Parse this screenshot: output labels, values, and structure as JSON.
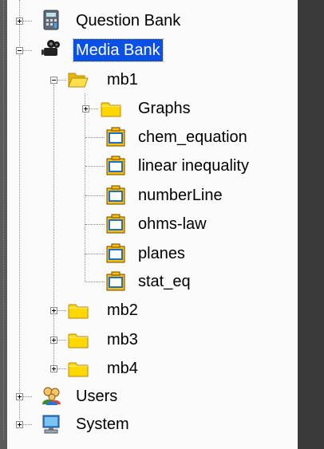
{
  "tree": {
    "question_bank": {
      "label": "Question Bank",
      "icon": "calculator-icon",
      "expanded": false
    },
    "media_bank": {
      "label": "Media Bank",
      "icon": "video-camera-icon",
      "expanded": true,
      "selected": true,
      "children": {
        "mb1": {
          "label": "mb1",
          "icon": "open-folder-icon",
          "expanded": true,
          "children": [
            {
              "label": "Graphs",
              "icon": "folder-icon",
              "expanded": false
            },
            {
              "label": "chem_equation",
              "icon": "media-item-icon"
            },
            {
              "label": "linear inequality",
              "icon": "media-item-icon"
            },
            {
              "label": "numberLine",
              "icon": "media-item-icon"
            },
            {
              "label": "ohms-law",
              "icon": "media-item-icon"
            },
            {
              "label": "planes",
              "icon": "media-item-icon"
            },
            {
              "label": "stat_eq",
              "icon": "media-item-icon"
            }
          ]
        },
        "mb2": {
          "label": "mb2",
          "icon": "folder-icon",
          "expanded": false
        },
        "mb3": {
          "label": "mb3",
          "icon": "folder-icon",
          "expanded": false
        },
        "mb4": {
          "label": "mb4",
          "icon": "folder-icon",
          "expanded": false
        }
      }
    },
    "users": {
      "label": "Users",
      "icon": "users-icon",
      "expanded": false
    },
    "system": {
      "label": "System",
      "icon": "computer-icon",
      "expanded": false
    }
  },
  "colors": {
    "selection": "#0a50e6",
    "folder": "#ffd800",
    "media_item": "#ffc000"
  }
}
